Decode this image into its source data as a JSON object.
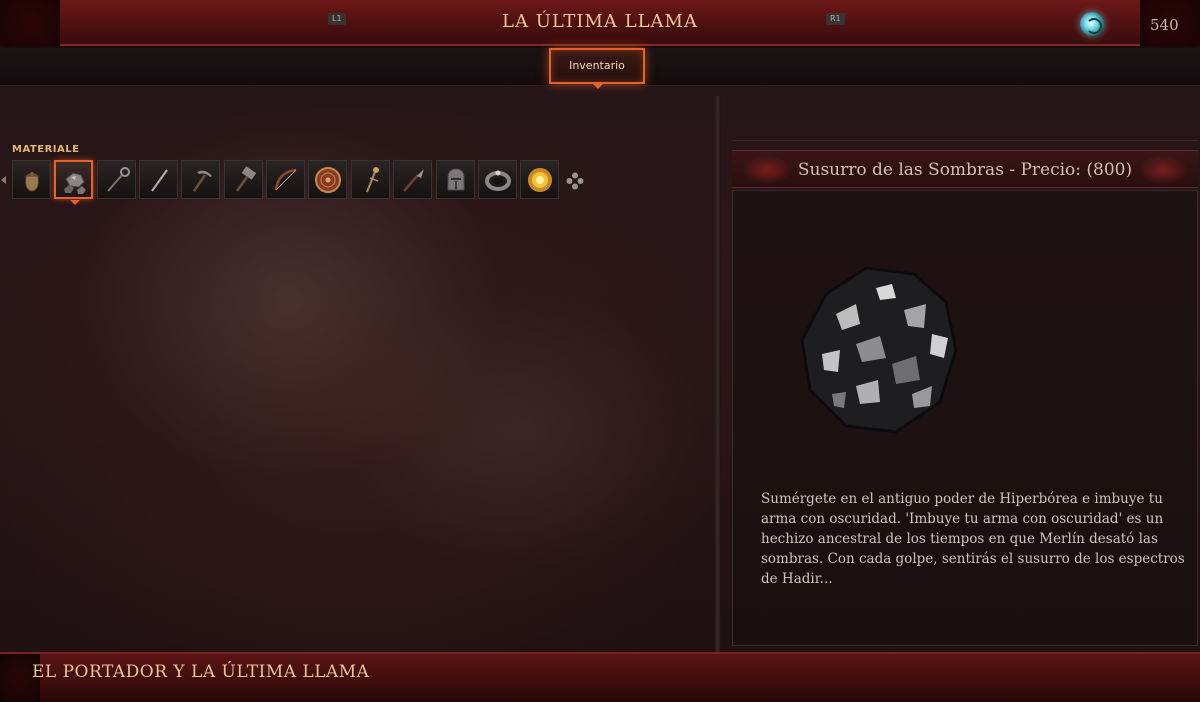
{
  "header": {
    "title": "LA ÚLTIMA LLAMA",
    "currency_value": "540",
    "currency_icon": "spirit-orb-icon"
  },
  "tabs": {
    "left_key": "L1",
    "right_key": "R1",
    "active_label": "Inventario"
  },
  "inventory": {
    "section_label": "MATERIALE",
    "selected_index": 1,
    "slots": [
      {
        "icon": "pouch-icon"
      },
      {
        "icon": "ore-stones-icon"
      },
      {
        "icon": "hook-staff-icon"
      },
      {
        "icon": "rod-icon"
      },
      {
        "icon": "pickaxe-icon"
      },
      {
        "icon": "hammer-icon"
      },
      {
        "icon": "bow-icon"
      },
      {
        "icon": "round-shield-icon"
      },
      {
        "icon": "scepter-icon"
      },
      {
        "icon": "spear-icon"
      },
      {
        "icon": "helmet-icon"
      },
      {
        "icon": "ring-icon"
      },
      {
        "icon": "golden-relic-icon"
      }
    ]
  },
  "detail": {
    "title": "Susurro de las Sombras - Precio: (800)",
    "description": "Sumérgete en el antiguo poder de Hiperbórea e imbuye tu arma con oscuridad. 'Imbuye tu arma con oscuridad' es un hechizo ancestral de los tiempos en que Merlín desató las sombras. Con cada golpe, sentirás el susurro de los espectros de Hadir..."
  },
  "footer": {
    "title": "EL PORTADOR Y LA ÚLTIMA LLAMA"
  }
}
